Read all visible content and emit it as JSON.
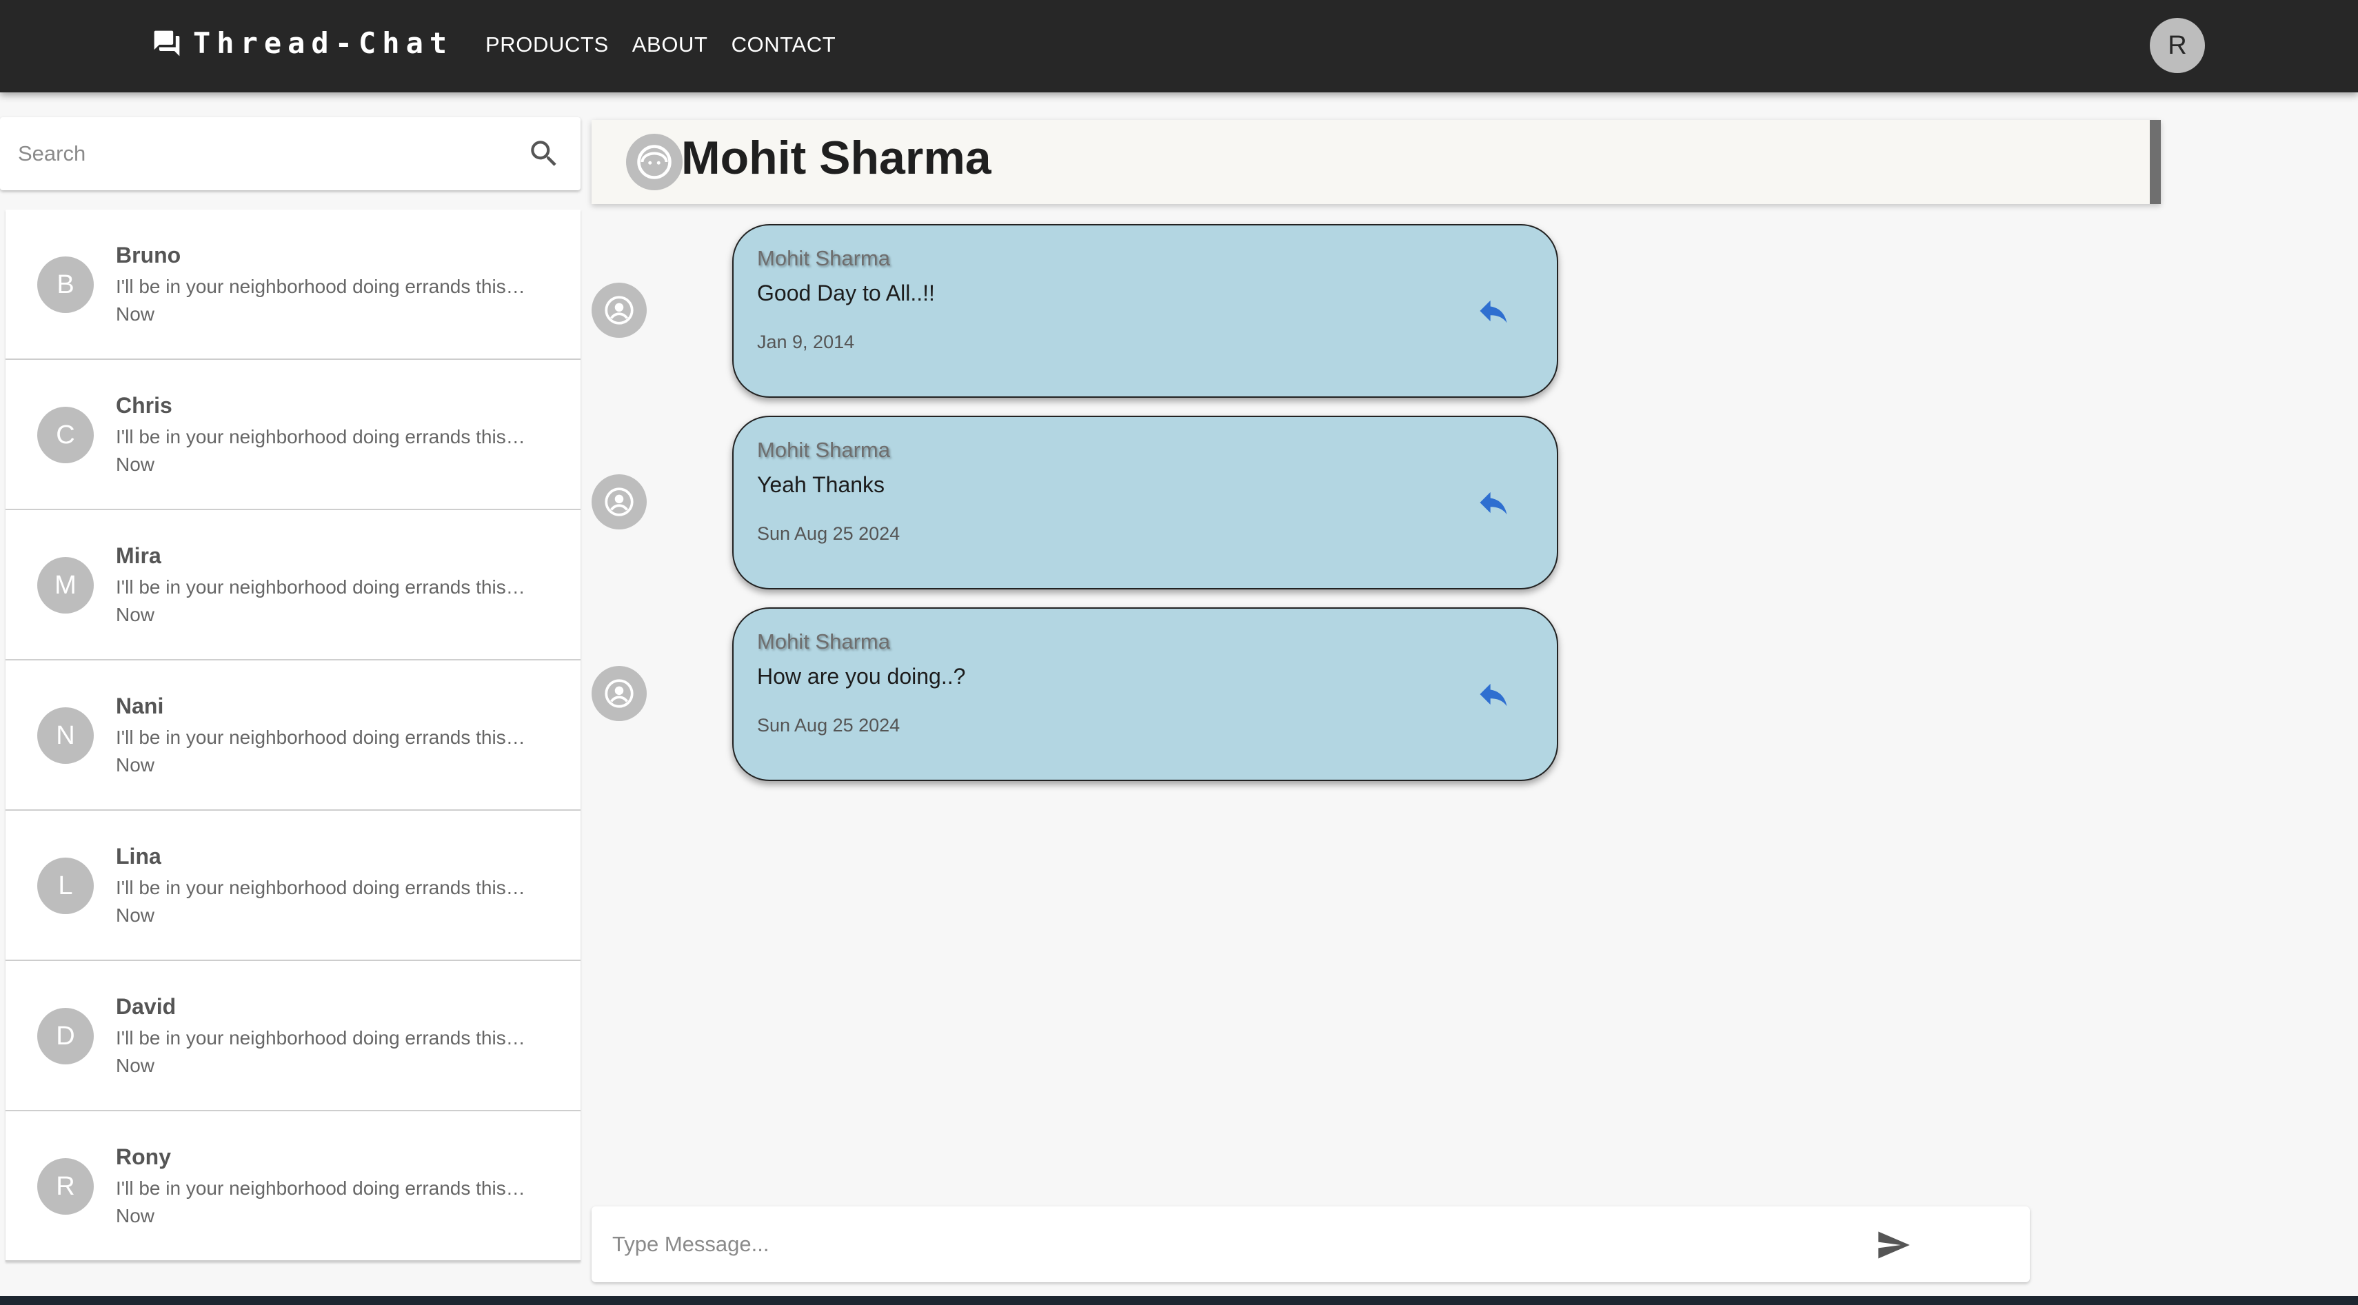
{
  "appbar": {
    "brand": "Thread-Chat",
    "brand_icon": "forum-icon",
    "nav": [
      "PRODUCTS",
      "ABOUT",
      "CONTACT"
    ],
    "user_initial": "R",
    "background": "#272727"
  },
  "sidebar": {
    "search_placeholder": "Search",
    "contacts": [
      {
        "initial": "B",
        "name": "Bruno",
        "preview": "I'll be in your neighborhood doing errands this…",
        "time": "Now"
      },
      {
        "initial": "C",
        "name": "Chris",
        "preview": "I'll be in your neighborhood doing errands this…",
        "time": "Now"
      },
      {
        "initial": "M",
        "name": "Mira",
        "preview": "I'll be in your neighborhood doing errands this…",
        "time": "Now"
      },
      {
        "initial": "N",
        "name": "Nani",
        "preview": "I'll be in your neighborhood doing errands this…",
        "time": "Now"
      },
      {
        "initial": "L",
        "name": "Lina",
        "preview": "I'll be in your neighborhood doing errands this…",
        "time": "Now"
      },
      {
        "initial": "D",
        "name": "David",
        "preview": "I'll be in your neighborhood doing errands this…",
        "time": "Now"
      },
      {
        "initial": "R",
        "name": "Rony",
        "preview": "I'll be in your neighborhood doing errands this…",
        "time": "Now"
      }
    ]
  },
  "chat": {
    "title": "Mohit Sharma",
    "messages": [
      {
        "author": "Mohit Sharma",
        "text": "Good Day to All..!!",
        "date": "Jan 9, 2014"
      },
      {
        "author": "Mohit Sharma",
        "text": "Yeah Thanks",
        "date": "Sun Aug 25 2024"
      },
      {
        "author": "Mohit Sharma",
        "text": "How are you doing..?",
        "date": "Sun Aug 25 2024"
      }
    ],
    "bubble_color": "#b3d6e2",
    "reply_icon_color": "#2f6fd0"
  },
  "composer": {
    "placeholder": "Type Message..."
  }
}
